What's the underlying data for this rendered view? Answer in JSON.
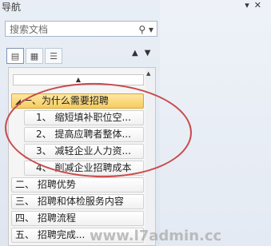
{
  "pane": {
    "title": "导航"
  },
  "search": {
    "placeholder": "搜索文档"
  },
  "tree": {
    "items": [
      {
        "label": "一、为什么需要招聘",
        "selected": true
      },
      {
        "label": "1、 缩短填补职位空..."
      },
      {
        "label": "2、 提高应聘者整体..."
      },
      {
        "label": "3、 减轻企业人力资..."
      },
      {
        "label": "4、 削减企业招聘成本"
      },
      {
        "label": "二、 招聘优势"
      },
      {
        "label": "三、 招聘和体检服务内容"
      },
      {
        "label": "四、 招聘流程"
      },
      {
        "label": "五、 招聘完成..."
      }
    ]
  },
  "watermark": "www.l7admin.cc",
  "colors": {
    "accent": "#f6cd5d",
    "annotation": "#c94a4a"
  }
}
